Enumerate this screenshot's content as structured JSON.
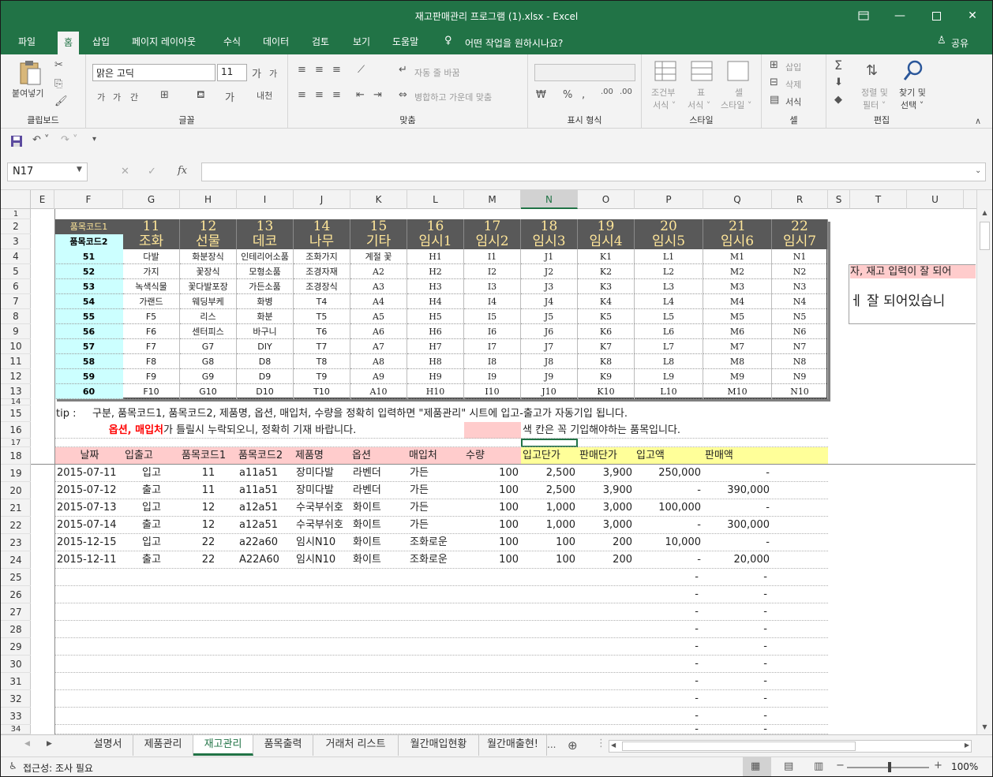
{
  "window": {
    "title": "재고판매관리 프로그램 (1).xlsx  -  Excel"
  },
  "tabs": [
    "파일",
    "홈",
    "삽입",
    "페이지 레이아웃",
    "수식",
    "데이터",
    "검토",
    "보기",
    "도움말"
  ],
  "tell_me": "어떤 작업을 원하시나요?",
  "share": "공유",
  "ribbon": {
    "clipboard": {
      "label": "클립보드",
      "paste": "붙여넣기"
    },
    "font": {
      "label": "글꼴",
      "font_name": "맑은 고딕",
      "font_size": "11"
    },
    "align": {
      "label": "맞춤",
      "wrap": "자동 줄 바꿈",
      "merge": "병합하고 가운데 맞춤"
    },
    "number": {
      "label": "표시 형식"
    },
    "styles": {
      "label": "스타일",
      "cond1": "조건부",
      "cond2": "서식 ˅",
      "table1": "표",
      "table2": "서식 ˅",
      "cell1": "셀",
      "cell2": "스타일 ˅"
    },
    "cells": {
      "label": "셀",
      "insert": "삽입",
      "delete": "삭제",
      "format": "서식"
    },
    "editing": {
      "label": "편집",
      "sort1": "정렬 및",
      "sort2": "필터 ˅",
      "find1": "찾기 및",
      "find2": "선택 ˅"
    }
  },
  "namebox": "N17",
  "columns": [
    "E",
    "F",
    "G",
    "H",
    "I",
    "J",
    "K",
    "L",
    "M",
    "N",
    "O",
    "P",
    "Q",
    "R",
    "S",
    "T",
    "U"
  ],
  "rows": [
    "1",
    "2",
    "3",
    "4",
    "5",
    "6",
    "7",
    "8",
    "9",
    "10",
    "11",
    "12",
    "13",
    "14",
    "15",
    "16",
    "17",
    "18",
    "19",
    "20",
    "21",
    "22",
    "23",
    "24",
    "25",
    "26",
    "27",
    "28",
    "29",
    "30",
    "31",
    "32",
    "33",
    "34"
  ],
  "code_table": {
    "row2_label": "품목코드1",
    "row3_label": "품목코드2",
    "codes1": [
      "11",
      "12",
      "13",
      "14",
      "15",
      "16",
      "17",
      "18",
      "19",
      "20",
      "21",
      "22"
    ],
    "names": [
      "조화",
      "선물",
      "데코",
      "나무",
      "기타",
      "임시1",
      "임시2",
      "임시3",
      "임시4",
      "임시5",
      "임시6",
      "임시7"
    ],
    "left_codes": [
      "51",
      "52",
      "53",
      "54",
      "55",
      "56",
      "57",
      "58",
      "59",
      "60"
    ],
    "body": [
      [
        "다발",
        "화분장식",
        "인테리어소품",
        "조화가지",
        "계절 꽃",
        "H1",
        "I1",
        "J1",
        "K1",
        "L1",
        "M1",
        "N1"
      ],
      [
        "가지",
        "꽃장식",
        "모형소품",
        "조경자재",
        "A2",
        "H2",
        "I2",
        "J2",
        "K2",
        "L2",
        "M2",
        "N2"
      ],
      [
        "녹색식물",
        "꽃다발포장",
        "가든소품",
        "조경장식",
        "A3",
        "H3",
        "I3",
        "J3",
        "K3",
        "L3",
        "M3",
        "N3"
      ],
      [
        "가랜드",
        "웨딩부케",
        "화병",
        "T4",
        "A4",
        "H4",
        "I4",
        "J4",
        "K4",
        "L4",
        "M4",
        "N4"
      ],
      [
        "F5",
        "리스",
        "화분",
        "T5",
        "A5",
        "H5",
        "I5",
        "J5",
        "K5",
        "L5",
        "M5",
        "N5"
      ],
      [
        "F6",
        "센터피스",
        "바구니",
        "T6",
        "A6",
        "H6",
        "I6",
        "J6",
        "K6",
        "L6",
        "M6",
        "N6"
      ],
      [
        "F7",
        "G7",
        "DIY",
        "T7",
        "A7",
        "H7",
        "I7",
        "J7",
        "K7",
        "L7",
        "M7",
        "N7"
      ],
      [
        "F8",
        "G8",
        "D8",
        "T8",
        "A8",
        "H8",
        "I8",
        "J8",
        "K8",
        "L8",
        "M8",
        "N8"
      ],
      [
        "F9",
        "G9",
        "D9",
        "T9",
        "A9",
        "H9",
        "I9",
        "J9",
        "K9",
        "L9",
        "M9",
        "N9"
      ],
      [
        "F10",
        "G10",
        "D10",
        "T10",
        "A10",
        "H10",
        "I10",
        "J10",
        "K10",
        "L10",
        "M10",
        "N10"
      ]
    ]
  },
  "tip": {
    "prefix": "tip  :",
    "line1": "구분, 품목코드1, 품목코드2, 제품명, 옵션, 매입처, 수량을 정확히 입력하면 \"제품관리\" 시트에 입고-출고가 자동기입 됩니다.",
    "line2_red": "옵션, 매입처",
    "line2_rest": " 가 틀릴시 누락되오니, 정확히 기재 바랍니다.",
    "legend": "색 칸은 꼭 기입해야하는 품목입니다."
  },
  "side_note": {
    "line1": "자, 재고 입력이 잘 되어",
    "line2": "ㅔ 잘 되어있습니"
  },
  "headers": [
    "날짜",
    "입출고",
    "품목코드1",
    "품목코드2",
    "제품명",
    "옵션",
    "매입처",
    "수량",
    "입고단가",
    "판매단가",
    "입고액",
    "판매액"
  ],
  "data_rows": [
    [
      "2015-07-11",
      "입고",
      "11",
      "a11a51",
      "장미다발",
      "라벤더",
      "가든",
      "100",
      "2,500",
      "3,900",
      "250,000",
      "-"
    ],
    [
      "2015-07-12",
      "출고",
      "11",
      "a11a51",
      "장미다발",
      "라벤더",
      "가든",
      "100",
      "2,500",
      "3,900",
      "-",
      "390,000"
    ],
    [
      "2015-07-13",
      "입고",
      "12",
      "a12a51",
      "수국부쉬호",
      "화이트",
      "가든",
      "100",
      "1,000",
      "3,000",
      "100,000",
      "-"
    ],
    [
      "2015-07-14",
      "출고",
      "12",
      "a12a51",
      "수국부쉬호",
      "화이트",
      "가든",
      "100",
      "1,000",
      "3,000",
      "-",
      "300,000"
    ],
    [
      "2015-12-15",
      "입고",
      "22",
      "a22a60",
      "임시N10",
      "화이트",
      "조화로운",
      "100",
      "100",
      "200",
      "10,000",
      "-"
    ],
    [
      "2015-12-11",
      "출고",
      "22",
      "A22A60",
      "임시N10",
      "화이트",
      "조화로운",
      "100",
      "100",
      "200",
      "-",
      "20,000"
    ]
  ],
  "dash": "-",
  "sheets": [
    "설명서",
    "제품관리",
    "재고관리",
    "품목출력",
    "거래처 리스트",
    "월간매입현황",
    "월간매출현!"
  ],
  "active_sheet": "재고관리",
  "status": {
    "accessibility": "접근성: 조사 필요",
    "zoom": "100%"
  },
  "colors": {
    "excel_green": "#217346",
    "header_gray": "#595959",
    "gold": "#ffe699",
    "aqua": "#ccffff",
    "pink": "#ffcccc",
    "yellow": "#ffff99"
  }
}
